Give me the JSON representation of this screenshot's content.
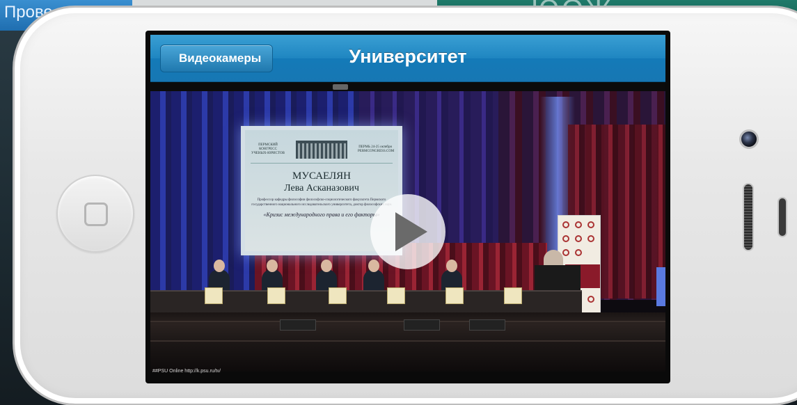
{
  "background": {
    "left_text": "Прове",
    "right_text": "ЮОЖ"
  },
  "app": {
    "nav": {
      "back_label": "Видеокамеры",
      "title": "Университет"
    },
    "video": {
      "slide": {
        "org_left": "ПЕРМСКИЙ КОНГРЕСС УЧЕНЫХ-ЮРИСТОВ",
        "org_right": "ПЕРМЬ 24-25 октября PERMCONGRESS.COM",
        "surname": "МУСАЕЛЯН",
        "name": "Лева Асканазович",
        "description": "Профессор кафедры философии философско-социологического факультета Пермского государственного национального исследовательского университета, доктор философских наук",
        "topic": "«Кризис международного права и его факторы»"
      },
      "caption": "##PSU Online http://k.psu.ru/tv/"
    }
  },
  "icons": [
    "home-button-icon",
    "front-camera-icon",
    "earpiece-speaker-icon",
    "proximity-sensor-icon",
    "play-icon",
    "back-chevron-icon"
  ]
}
